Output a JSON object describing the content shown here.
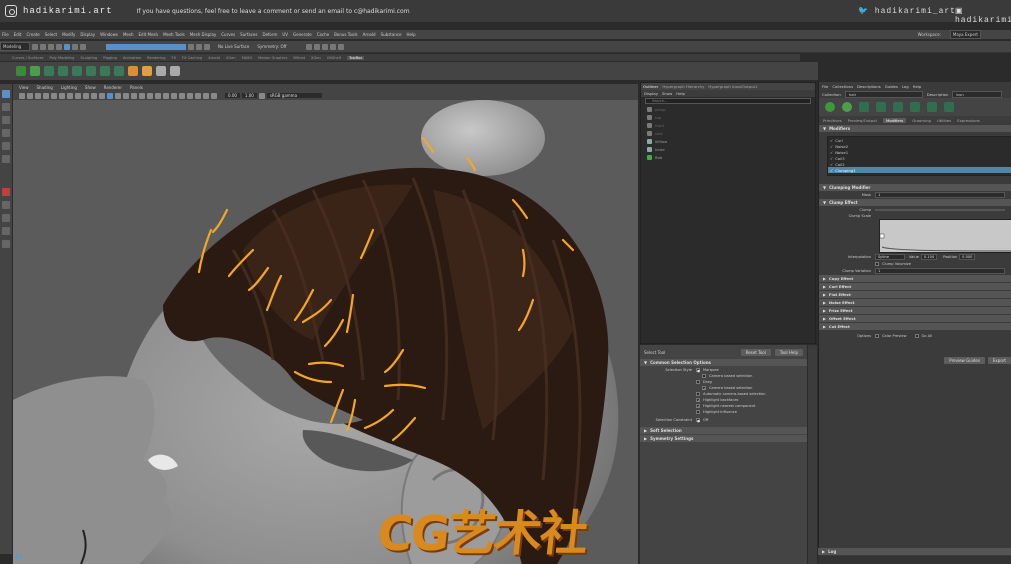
{
  "banner": {
    "handle": "hadikarimi.art",
    "message": "If you have questions, feel free to leave a comment or send an email to c@hadikarimi.com",
    "twitter": "hadikarimi_art",
    "facebook": "hadikarimi"
  },
  "menubar": [
    "File",
    "Edit",
    "Create",
    "Select",
    "Modify",
    "Display",
    "Windows",
    "Mesh",
    "Edit Mesh",
    "Mesh Tools",
    "Mesh Display",
    "Curves",
    "Surfaces",
    "Deform",
    "UV",
    "Generate",
    "Cache",
    "Bonus Tools",
    "Arnold",
    "Substance",
    "Help"
  ],
  "workspace": {
    "label": "Workspace:",
    "value": "Maya Expert"
  },
  "status": {
    "mode": "Modeling",
    "live_surface": "No Live Surface",
    "symmetry": "Symmetry: Off"
  },
  "shelf_tabs": [
    {
      "label": "Curves / Surfaces"
    },
    {
      "label": "Poly Modeling"
    },
    {
      "label": "Sculpting"
    },
    {
      "label": "Rigging"
    },
    {
      "label": "Animation"
    },
    {
      "label": "Rendering"
    },
    {
      "label": "FX"
    },
    {
      "label": "FX Caching"
    },
    {
      "label": "Arnold"
    },
    {
      "label": "XGen"
    },
    {
      "label": "MASH"
    },
    {
      "label": "Motion Graphics"
    },
    {
      "label": "Bifrost"
    },
    {
      "label": "XGen"
    },
    {
      "label": "GitShelf"
    },
    {
      "label": "TowBox",
      "active": true
    }
  ],
  "viewport": {
    "menu": [
      "View",
      "Shading",
      "Lighting",
      "Show",
      "Renderer",
      "Panels"
    ],
    "exposure": "0.00",
    "gamma": "1.00",
    "colorspace": "sRGB gamma"
  },
  "watermark": "CG艺术社",
  "outliner": {
    "tabs": [
      {
        "label": "Outliner",
        "active": true
      },
      {
        "label": "Hypergraph Hierarchy"
      },
      {
        "label": "Hypergraph InputOutput1"
      }
    ],
    "menu": [
      "Display",
      "Show",
      "Help"
    ],
    "search_placeholder": "Search...",
    "items": [
      {
        "label": "persp",
        "dim": true
      },
      {
        "label": "top",
        "dim": true
      },
      {
        "label": "front",
        "dim": true
      },
      {
        "label": "side",
        "dim": true
      },
      {
        "label": "Willow",
        "dim": false
      },
      {
        "label": "head",
        "dim": false
      },
      {
        "label": "Bob",
        "dim": false
      }
    ]
  },
  "toolset": {
    "title": "Select Tool",
    "reset": "Reset Tool",
    "help": "Tool Help",
    "sections": {
      "common": "Common Selection Options",
      "soft": "Soft Selection",
      "symmetry": "Symmetry Settings"
    },
    "selection_style": "Selection Style",
    "marquee": "Marquee",
    "camera_based": "Camera based selection",
    "drag": "Drag",
    "camera_based2": "Camera based selection",
    "auto_cam": "Automatic camera-based selection",
    "highlight_backfaces": "Highlight backfaces",
    "highlight_nearest": "Highlight nearest component",
    "highlight_influence": "Highlight Influence",
    "constraint_label": "Selection Constraint",
    "constraint_value": "Off"
  },
  "xgen": {
    "menu": [
      "File",
      "Collections",
      "Descriptions",
      "Guides",
      "Log",
      "Help"
    ],
    "collection_label": "Collection",
    "collection_value": "hair",
    "description_label": "Description",
    "description_value": "bun",
    "tabs": [
      {
        "label": "Primitives"
      },
      {
        "label": "Preview/Output"
      },
      {
        "label": "Modifiers",
        "active": true
      },
      {
        "label": "Grooming"
      },
      {
        "label": "Utilities"
      },
      {
        "label": "Expressions"
      }
    ],
    "modifiers_section": "Modifiers",
    "modifiers": [
      {
        "label": "Curl",
        "selected": false
      },
      {
        "label": "Noise2",
        "selected": false
      },
      {
        "label": "Noise1",
        "selected": false
      },
      {
        "label": "Coil3",
        "selected": false
      },
      {
        "label": "Coil2",
        "selected": false
      },
      {
        "label": "Clumping1",
        "selected": true
      }
    ],
    "clumping_section": "Clumping Modifier",
    "mask_label": "Mask",
    "mask_value": "1",
    "clump_effect": "Clump Effect",
    "clump_label": "Clump",
    "clump_scale_label": "Clump Scale",
    "interp_label": "Interpolation",
    "interp_value": "Spline",
    "value_label": "Value",
    "value_value": "0.104",
    "position_label": "Position",
    "position_value": "0.000",
    "clump_vol": "Clump Volumize",
    "clump_variation_label": "Clump Variation",
    "clump_variation_value": "1",
    "effects": [
      "Copy Effect",
      "Curl Effect",
      "Flat Effect",
      "Noise Effect",
      "Frizz Effect",
      "Offset Effect",
      "Cut Effect"
    ],
    "options_label": "Options",
    "color_preview": "Color Preview",
    "go_all": "Go All",
    "preview_button": "Preview Guides",
    "export_button": "Export",
    "log_label": "Log"
  },
  "colors": {
    "accent": "#5285a6",
    "guide_orange": "#f5a623",
    "panel": "#444444"
  }
}
